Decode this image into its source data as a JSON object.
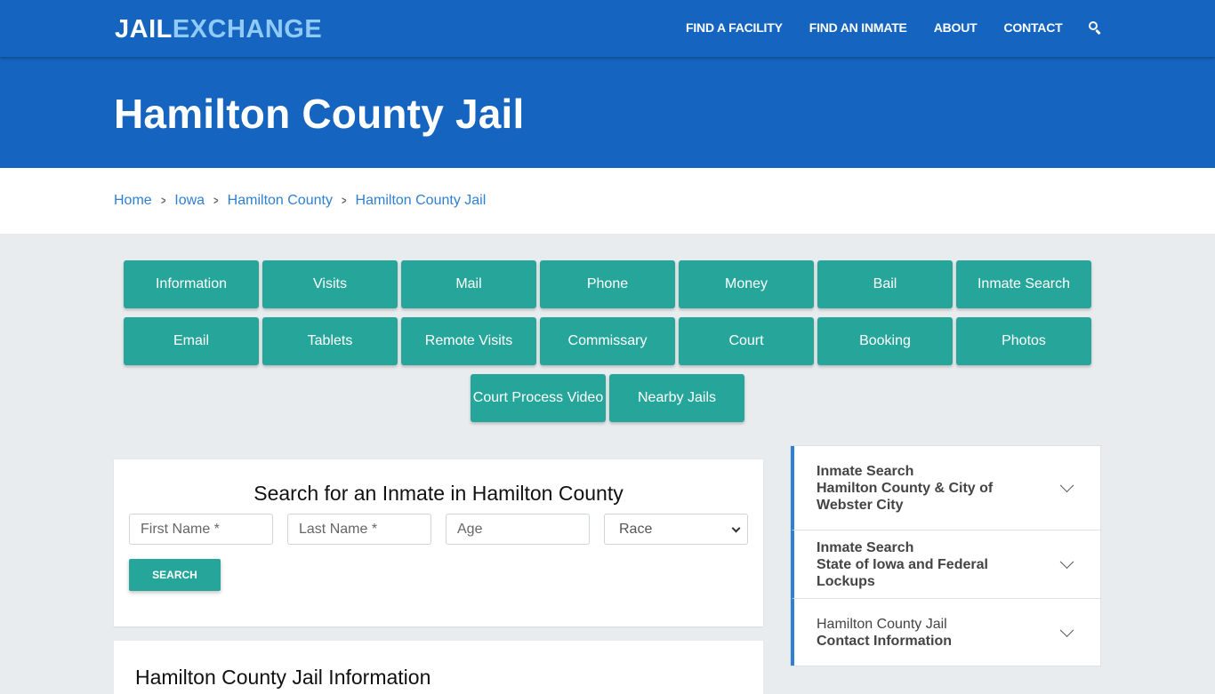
{
  "header": {
    "logo_part1": "JAIL",
    "logo_part2": "EXCHANGE",
    "nav": [
      "FIND A FACILITY",
      "FIND AN INMATE",
      "ABOUT",
      "CONTACT"
    ],
    "search_icon": "search-icon"
  },
  "hero": {
    "title": "Hamilton County Jail"
  },
  "breadcrumb": {
    "items": [
      "Home",
      "Iowa",
      "Hamilton County",
      "Hamilton County Jail"
    ],
    "separator_icon": "chevron-right-icon"
  },
  "tiles": [
    "Information",
    "Visits",
    "Mail",
    "Phone",
    "Money",
    "Bail",
    "Inmate Search",
    "Email",
    "Tablets",
    "Remote Visits",
    "Commissary",
    "Court",
    "Booking",
    "Photos",
    "Court Process Video",
    "Nearby Jails"
  ],
  "search": {
    "title": "Search for an Inmate in Hamilton County",
    "first_name_placeholder": "First Name *",
    "last_name_placeholder": "Last Name *",
    "age_placeholder": "Age",
    "race_selected": "Race",
    "button": "SEARCH"
  },
  "info": {
    "title": "Hamilton County Jail Information"
  },
  "sidebar": {
    "items": [
      {
        "line1": "Inmate Search",
        "line2": "Hamilton County & City of Webster City"
      },
      {
        "line1": "Inmate Search",
        "line2": "State of Iowa and Federal Lockups"
      },
      {
        "line1": "Hamilton County Jail",
        "line2": "Contact Information"
      }
    ]
  },
  "colors": {
    "brand_blue": "#1565c0",
    "logo_accent": "#90caf9",
    "tile_teal": "#26a69a",
    "link_blue": "#2f80d1",
    "page_bg": "#e9ecef"
  }
}
